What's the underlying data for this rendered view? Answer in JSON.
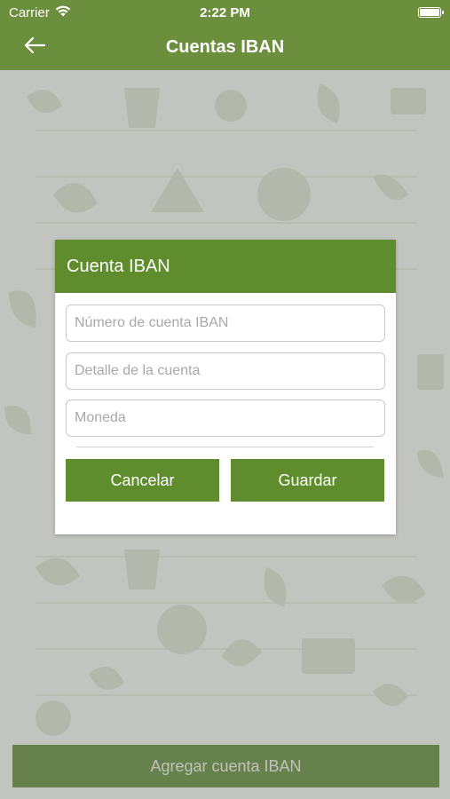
{
  "status_bar": {
    "carrier": "Carrier",
    "time": "2:22 PM",
    "wifi_icon": "wifi-icon",
    "battery_icon": "battery-full-icon"
  },
  "nav_bar": {
    "title": "Cuentas IBAN",
    "back_icon": "arrow-left-icon"
  },
  "dialog": {
    "title": "Cuenta IBAN",
    "fields": [
      {
        "placeholder": "Número de cuenta IBAN",
        "value": ""
      },
      {
        "placeholder": "Detalle de la cuenta",
        "value": ""
      },
      {
        "placeholder": "Moneda",
        "value": ""
      }
    ],
    "cancel_label": "Cancelar",
    "save_label": "Guardar"
  },
  "add_button_label": "Agregar cuenta IBAN",
  "colors": {
    "primary_green": "#5f8d2e",
    "bar_green": "#6b8f3c",
    "background_pattern": "#eef2ea"
  }
}
